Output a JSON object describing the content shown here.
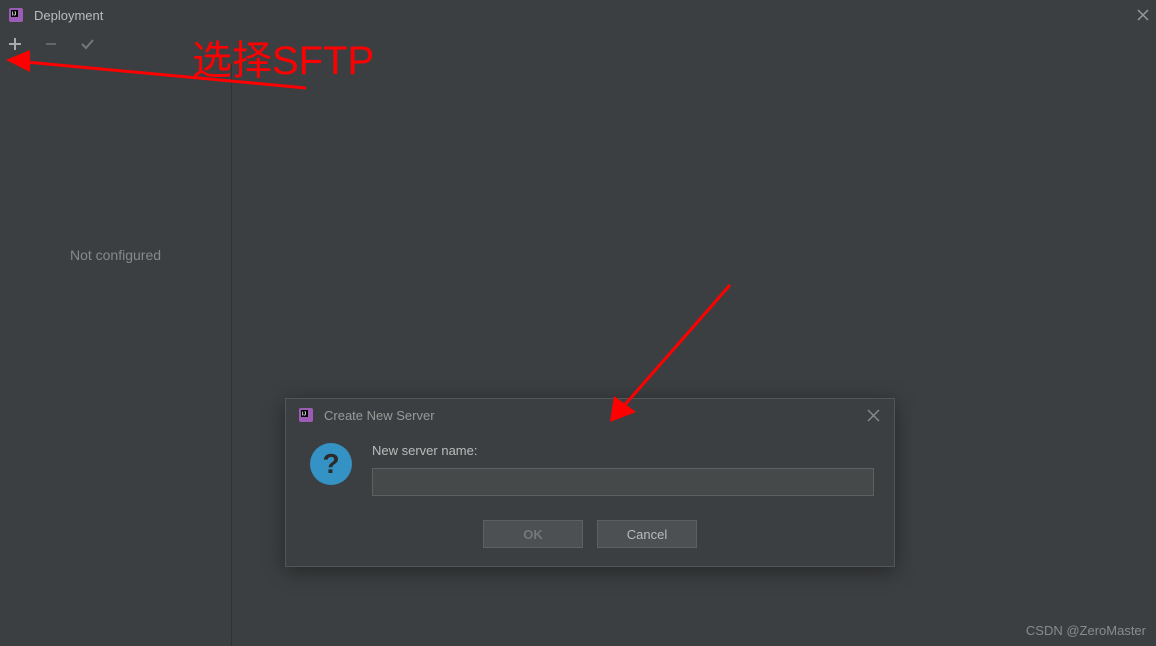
{
  "header": {
    "title": "Deployment"
  },
  "sidebar": {
    "empty_text": "Not configured"
  },
  "dialog": {
    "title": "Create New Server",
    "label": "New server name:",
    "input_value": "",
    "ok_label": "OK",
    "cancel_label": "Cancel"
  },
  "annotation": {
    "text": "选择SFTP"
  },
  "watermark": "CSDN @ZeroMaster"
}
